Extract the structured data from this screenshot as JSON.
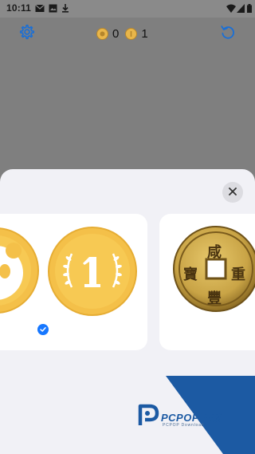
{
  "status_bar": {
    "time": "10:11",
    "icons": [
      "mail-icon",
      "image-icon",
      "download-icon",
      "wifi-icon",
      "signal-icon",
      "battery-icon"
    ]
  },
  "toolbar": {
    "settings_icon": "gear-icon",
    "reset_icon": "refresh-icon",
    "counters": [
      {
        "icon": "coin-badge-icon",
        "value": "0"
      },
      {
        "icon": "coin-one-icon",
        "value": "1"
      }
    ]
  },
  "sheet": {
    "close_icon": "close-icon",
    "cards": [
      {
        "coins": [
          "panda-coin",
          "one-coin"
        ],
        "selected_coin": "one-coin"
      },
      {
        "coins": [
          "chinese-cash-coin"
        ]
      }
    ],
    "cash_coin_characters": [
      "咸",
      "豐",
      "重",
      "寶"
    ]
  },
  "watermark": {
    "brand": "PCPOP下载",
    "sub": "PCPOP Download"
  },
  "colors": {
    "accent": "#1a6fd6",
    "coin_gold": "#f4c049",
    "sheet_bg": "#f1f1f6",
    "overlay": "#7f7f7f"
  }
}
